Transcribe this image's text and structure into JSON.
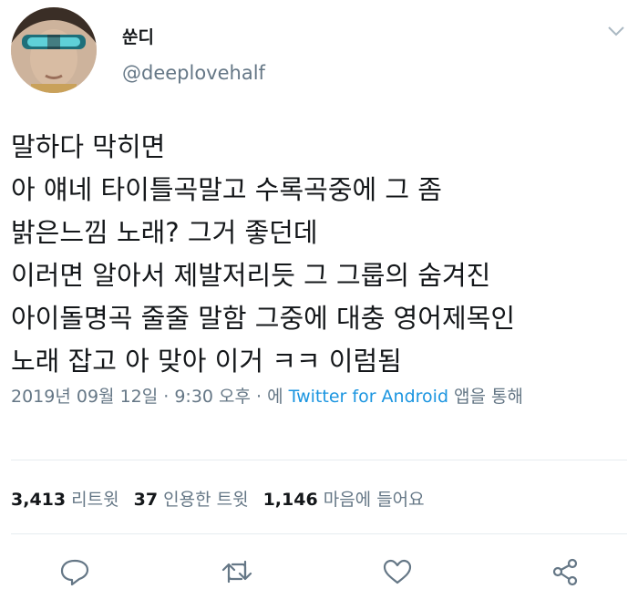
{
  "user": {
    "name": "쑨디",
    "handle": "@deeplovehalf"
  },
  "tweet": {
    "lines": [
      "말하다 막히면",
      "아 얘네 타이틀곡말고 수록곡중에 그 좀",
      "밝은느낌 노래? 그거 좋던데",
      "이러면 알아서 제발저리듯 그 그룹의 숨겨진",
      "아이돌명곡 줄줄 말함 그중에 대충 영어제목인",
      "노래 잡고 아 맞아 이거 ㅋㅋ 이럼됨"
    ]
  },
  "meta": {
    "datetime": "2019년 09월 12일 · 9:30 오후 · 에 ",
    "source": "Twitter for Android",
    "suffix": " 앱을 통해"
  },
  "stats": {
    "retweets_count": "3,413",
    "retweets_label": "리트윗",
    "quotes_count": "37",
    "quotes_label": "인용한 트윗",
    "likes_count": "1,146",
    "likes_label": "마음에 들어요"
  },
  "icons": {
    "reply": "reply-icon",
    "retweet": "retweet-icon",
    "like": "heart-icon",
    "share": "share-icon",
    "caret": "chevron-down-icon"
  },
  "colors": {
    "text": "#14171a",
    "secondary": "#657786",
    "link": "#1b95e0",
    "divider": "#e6ecf0"
  }
}
